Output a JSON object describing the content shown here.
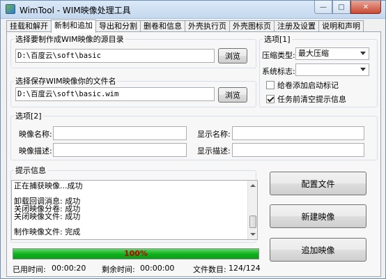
{
  "window": {
    "title": "WimTool - WIM映像处理工具",
    "min": "—",
    "max": "□",
    "close": "✕"
  },
  "tabs": [
    {
      "label": "挂载和解开"
    },
    {
      "label": "新制和追加"
    },
    {
      "label": "导出和分割"
    },
    {
      "label": "删卷和信息"
    },
    {
      "label": "外壳执行页"
    },
    {
      "label": "外壳图标页"
    },
    {
      "label": "注册及设置"
    },
    {
      "label": "说明和声明"
    }
  ],
  "source": {
    "label": "选择要制作成WIM映像的源目录",
    "value": "D:\\百度云\\soft\\basic",
    "browse": "浏览"
  },
  "target": {
    "label": "选择保存WIM映像你的文件名",
    "value": "D:\\百度云\\soft\\basic.wim",
    "browse": "浏览"
  },
  "options1": {
    "legend": "选项[1]",
    "compress_label": "压缩类型:",
    "compress_value": "最大压缩",
    "flag_label": "系统标志:",
    "flag_value": "",
    "add_boot_label": "给卷添加启动标记",
    "add_boot_checked": false,
    "clear_prompt_label": "任务前清空提示信息",
    "clear_prompt_checked": true
  },
  "options2": {
    "legend": "选项[2]",
    "image_name_label": "映像名称:",
    "image_name_value": "",
    "display_name_label": "显示名称:",
    "display_name_value": "",
    "image_desc_label": "映像描述:",
    "image_desc_value": "",
    "display_desc_label": "显示描述:",
    "display_desc_value": ""
  },
  "log": {
    "legend": "提示信息",
    "lines": [
      "正在捕获映像...成功",
      "",
      "卸载回调消息: 成功",
      "关闭映像分卷: 成功",
      "关闭映像文件: 成功",
      "",
      "制作映像文件: 完成"
    ]
  },
  "progress": {
    "value": 1.0,
    "text": "100%"
  },
  "status": {
    "elapsed_label": "已用时间:",
    "elapsed_value": "00:00:20",
    "remaining_label": "剩余时间:",
    "remaining_value": "00:00:00",
    "files_label": "文件数目:",
    "files_value": "124/124"
  },
  "buttons": {
    "config": "配置文件",
    "create": "新建映像",
    "append": "追加映像"
  }
}
